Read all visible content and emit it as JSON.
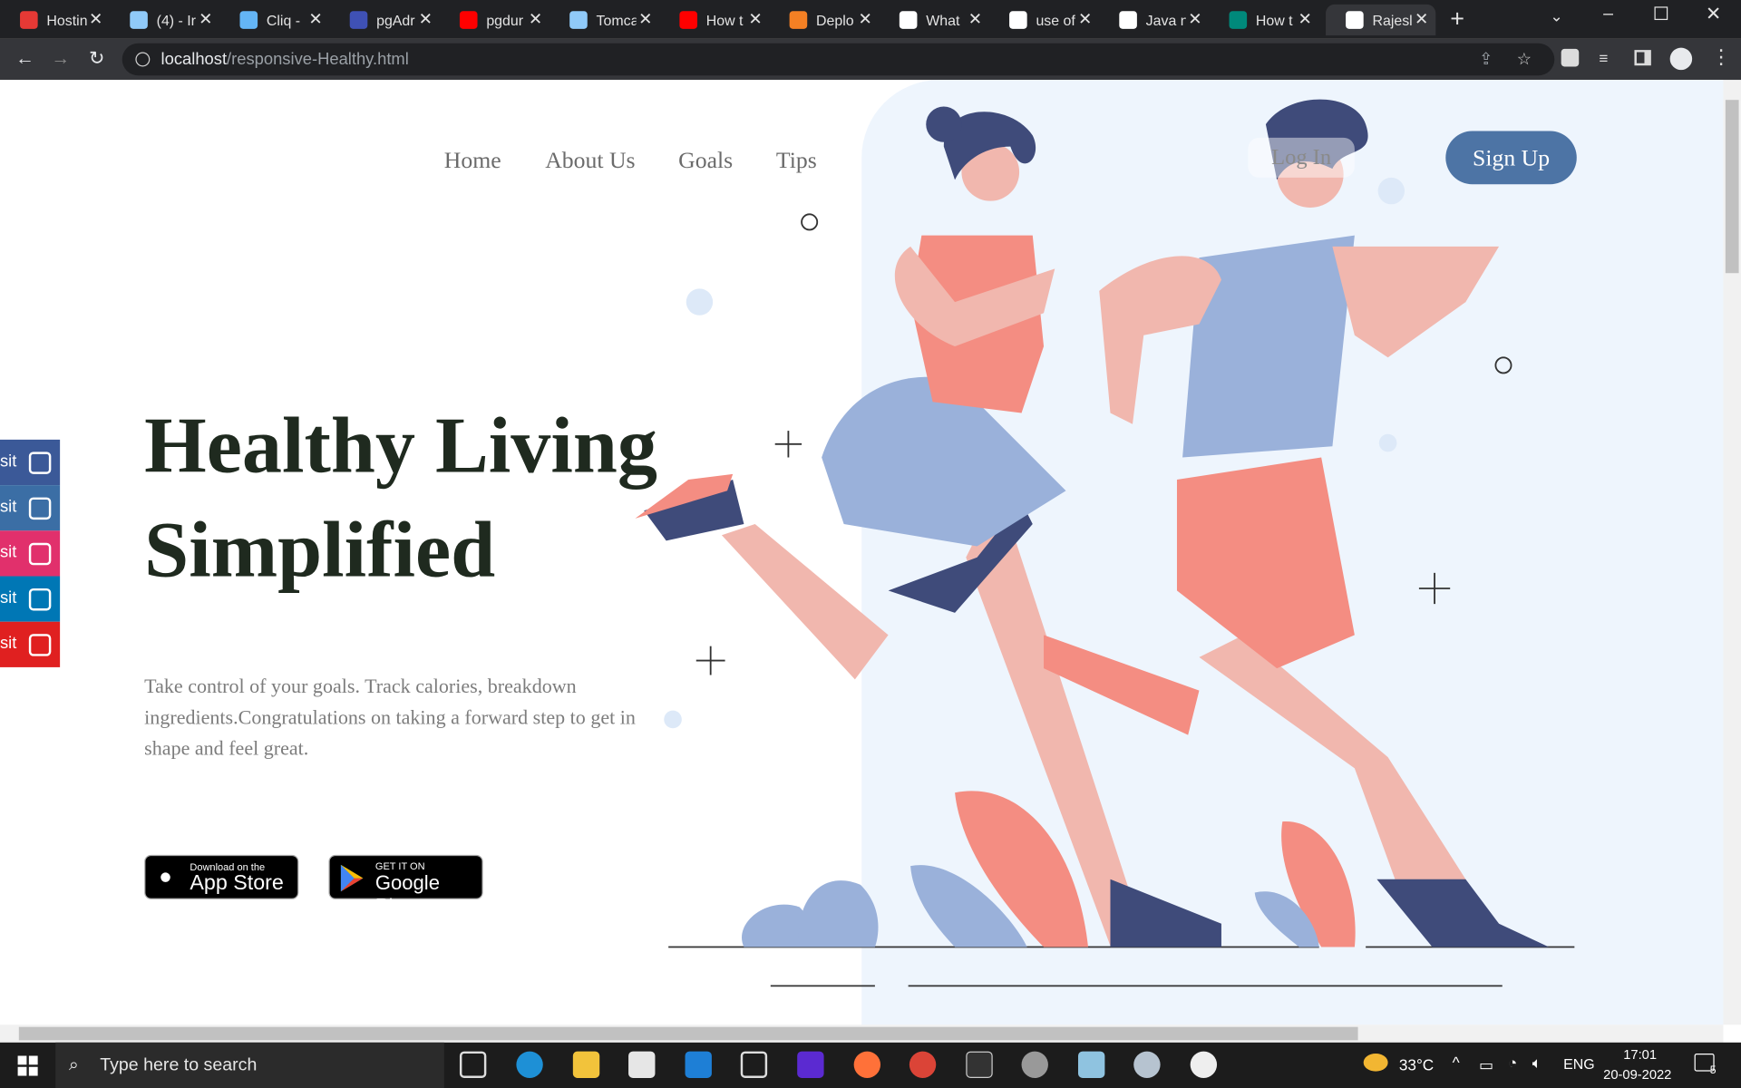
{
  "browser": {
    "tabs": [
      {
        "label": "Hostin",
        "color": "#e53935"
      },
      {
        "label": "(4) - Ir",
        "color": "#90caf9"
      },
      {
        "label": "Cliq -",
        "color": "#64b5f6"
      },
      {
        "label": "pgAdr",
        "color": "#3f51b5"
      },
      {
        "label": "pgdur",
        "color": "#ff0000"
      },
      {
        "label": "Tomca",
        "color": "#90caf9"
      },
      {
        "label": "How t",
        "color": "#ff0000"
      },
      {
        "label": "Deplo",
        "color": "#f48024"
      },
      {
        "label": "What",
        "color": "#ffffff"
      },
      {
        "label": "use of",
        "color": "#ffffff"
      },
      {
        "label": "Java n",
        "color": "#ffffff"
      },
      {
        "label": "How t",
        "color": "#00897b"
      },
      {
        "label": "Rajesl",
        "color": "#ffffff"
      }
    ],
    "new_tab": "+",
    "url_host": "localhost",
    "url_path": "/responsive-Healthy.html"
  },
  "nav": {
    "items": [
      "Home",
      "About Us",
      "Goals",
      "Tips"
    ],
    "login": "Log In",
    "signup": "Sign Up"
  },
  "hero": {
    "line1": "Healthy Living",
    "line2": "Simplified",
    "description": "Take control of your goals. Track calories, breakdown ingredients.Congratulations on taking a forward step to get in shape and feel great."
  },
  "stores": {
    "apple_small": "Download on the",
    "apple_big": "App Store",
    "google_small": "GET IT ON",
    "google_big": "Google Play"
  },
  "social": [
    {
      "label": "sit",
      "icon": "facebook-icon",
      "color": "#3b5998"
    },
    {
      "label": "sit",
      "icon": "telegram-icon",
      "color": "#3b6ea5"
    },
    {
      "label": "sit",
      "icon": "instagram-icon",
      "color": "#e1306c"
    },
    {
      "label": "sit",
      "icon": "linkedin-icon",
      "color": "#0077b5"
    },
    {
      "label": "sit",
      "icon": "youtube-icon",
      "color": "#e02020"
    }
  ],
  "taskbar": {
    "search_placeholder": "Type here to search",
    "weather": "33°C",
    "lang": "ENG",
    "time": "17:01",
    "date": "20-09-2022",
    "notifications": "5"
  }
}
